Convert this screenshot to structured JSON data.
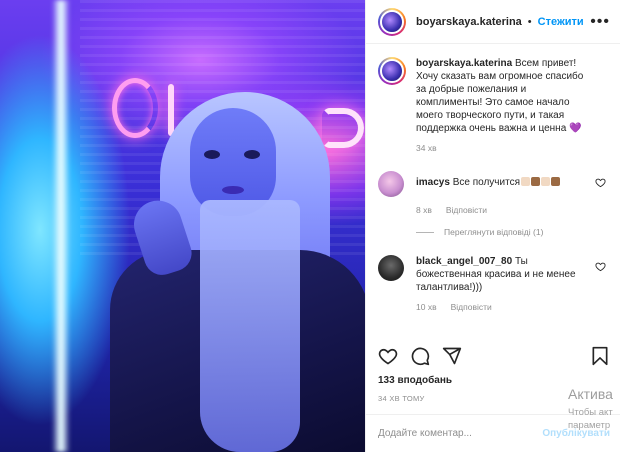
{
  "post": {
    "username": "boyarskaya.katerina",
    "separator": "•",
    "follow_label": "Стежити",
    "more_label": "•••"
  },
  "caption": {
    "username": "boyarskaya.katerina",
    "text": "Всем привет! Хочу сказать вам огромное спасибо за добрые пожелания и комплименты! Это самое начало моего творческого пути, и такая поддержка очень важна и ценна 💜",
    "time": "34 хв"
  },
  "comments": [
    {
      "username": "imacys",
      "text": "Все получится",
      "emoji_colors": [
        "#f1d9c3",
        "#9b6a43",
        "#f1d9c3",
        "#9b6a43"
      ],
      "time": "8 хв",
      "reply_label": "Відповісти",
      "view_replies_label": "Переглянути відповіді (1)",
      "avatar_color": "#c98fd0"
    },
    {
      "username": "black_angel_007_80",
      "text": "Ты божественная красива и не менее талантлива!)))",
      "time": "10 хв",
      "reply_label": "Відповісти",
      "avatar_color": "#2c2c2c"
    }
  ],
  "icons": [
    "heart-icon",
    "comment-icon",
    "share-icon",
    "bookmark-icon"
  ],
  "likes_label": "133 вподобань",
  "timestamp": "34 ХВ ТОМУ",
  "comment_box": {
    "placeholder": "Додайте коментар...",
    "publish_label": "Опублікувати"
  },
  "watermark": {
    "line1": "Актива",
    "line2": "Чтобы акт",
    "line3": "параметр"
  },
  "colors": {
    "accent": "#0095f6",
    "publish_disabled": "#b2dffc",
    "muted": "#8e8e8e"
  }
}
